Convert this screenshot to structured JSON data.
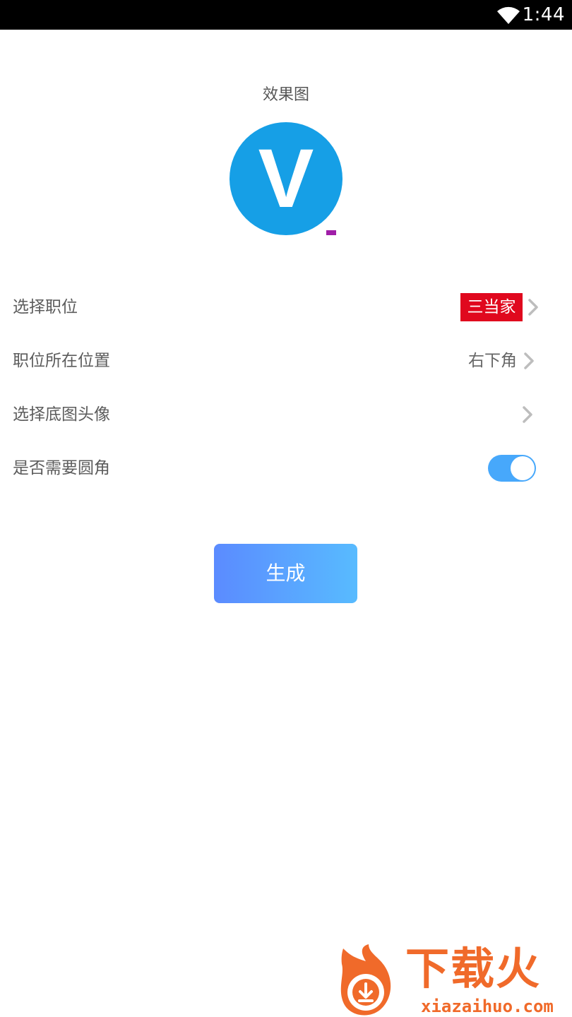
{
  "status_bar": {
    "time": "1:44",
    "icons": [
      "wifi-icon"
    ],
    "background": "#000000"
  },
  "preview": {
    "label": "效果图",
    "avatar_letter": "V",
    "avatar_color": "#169fe6"
  },
  "settings": {
    "rows": [
      {
        "label": "选择职位",
        "value": "三当家",
        "value_style": "tag",
        "tag_color": "#e0081e"
      },
      {
        "label": "职位所在位置",
        "value": "右下角"
      },
      {
        "label": "选择底图头像",
        "value": ""
      },
      {
        "label": "是否需要圆角",
        "toggle_on": true,
        "toggle_color": "#47a8fb"
      }
    ]
  },
  "actions": {
    "generate_label": "生成"
  },
  "watermark": {
    "brand": "下载火",
    "url": "xiazaihuo.com"
  }
}
